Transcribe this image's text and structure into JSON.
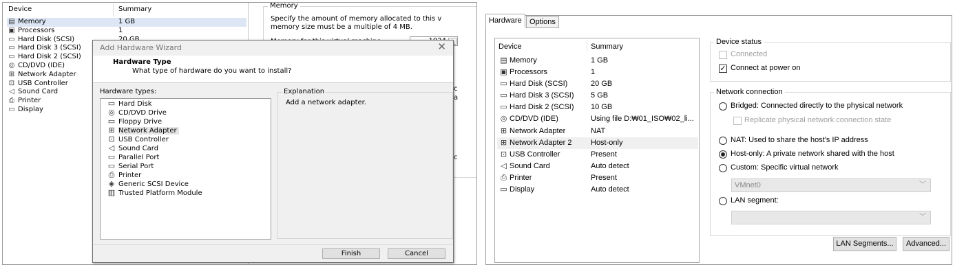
{
  "left_panel": {
    "col_device": "Device",
    "col_summary": "Summary",
    "devices": [
      {
        "icon": "memory-icon",
        "glyph": "▤",
        "name": "Memory",
        "summary": "1 GB"
      },
      {
        "icon": "processor-icon",
        "glyph": "▣",
        "name": "Processors",
        "summary": "1"
      },
      {
        "icon": "hard-disk-icon",
        "glyph": "▭",
        "name": "Hard Disk (SCSI)",
        "summary": "20 GB"
      },
      {
        "icon": "hard-disk-icon",
        "glyph": "▭",
        "name": "Hard Disk 3 (SCSI)",
        "summary": ""
      },
      {
        "icon": "hard-disk-icon",
        "glyph": "▭",
        "name": "Hard Disk 2 (SCSI)",
        "summary": ""
      },
      {
        "icon": "cd-dvd-icon",
        "glyph": "◎",
        "name": "CD/DVD (IDE)",
        "summary": ""
      },
      {
        "icon": "network-adapter-icon",
        "glyph": "⊞",
        "name": "Network Adapter",
        "summary": ""
      },
      {
        "icon": "usb-controller-icon",
        "glyph": "⊡",
        "name": "USB Controller",
        "summary": ""
      },
      {
        "icon": "sound-card-icon",
        "glyph": "◁",
        "name": "Sound Card",
        "summary": ""
      },
      {
        "icon": "printer-icon",
        "glyph": "⎙",
        "name": "Printer",
        "summary": ""
      },
      {
        "icon": "display-icon",
        "glyph": "▭",
        "name": "Display",
        "summary": ""
      }
    ],
    "memory": {
      "legend": "Memory",
      "desc_line1": "Specify the amount of memory allocated to this v",
      "desc_line2": "memory size must be a multiple of 4 MB.",
      "field_label": "Memory for this virtual machine:",
      "field_value": "1024"
    },
    "edge_letters": [
      "c",
      "a",
      "c"
    ]
  },
  "wizard": {
    "title": "Add Hardware Wizard",
    "close_glyph": "✕",
    "heading": "Hardware Type",
    "subheading": "What type of hardware do you want to install?",
    "types_label": "Hardware types:",
    "types": [
      {
        "icon": "hard-disk-icon",
        "glyph": "▭",
        "label": "Hard Disk"
      },
      {
        "icon": "cd-dvd-icon",
        "glyph": "◎",
        "label": "CD/DVD Drive"
      },
      {
        "icon": "floppy-drive-icon",
        "glyph": "▭",
        "label": "Floppy Drive"
      },
      {
        "icon": "network-adapter-icon",
        "glyph": "⊞",
        "label": "Network Adapter",
        "selected": true
      },
      {
        "icon": "usb-controller-icon",
        "glyph": "⊡",
        "label": "USB Controller"
      },
      {
        "icon": "sound-card-icon",
        "glyph": "◁",
        "label": "Sound Card"
      },
      {
        "icon": "parallel-port-icon",
        "glyph": "▭",
        "label": "Parallel Port"
      },
      {
        "icon": "serial-port-icon",
        "glyph": "▭",
        "label": "Serial Port"
      },
      {
        "icon": "printer-icon",
        "glyph": "⎙",
        "label": "Printer"
      },
      {
        "icon": "generic-scsi-icon",
        "glyph": "◈",
        "label": "Generic SCSI Device"
      },
      {
        "icon": "tpm-icon",
        "glyph": "▥",
        "label": "Trusted Platform Module"
      }
    ],
    "explanation_legend": "Explanation",
    "explanation_text": "Add a network adapter.",
    "finish_label": "Finish",
    "cancel_label": "Cancel"
  },
  "right_panel": {
    "tabs": [
      {
        "label": "Hardware",
        "active": true
      },
      {
        "label": "Options",
        "active": false
      }
    ],
    "col_device": "Device",
    "col_summary": "Summary",
    "devices": [
      {
        "icon": "memory-icon",
        "glyph": "▤",
        "name": "Memory",
        "summary": "1 GB"
      },
      {
        "icon": "processor-icon",
        "glyph": "▣",
        "name": "Processors",
        "summary": "1"
      },
      {
        "icon": "hard-disk-icon",
        "glyph": "▭",
        "name": "Hard Disk (SCSI)",
        "summary": "20 GB"
      },
      {
        "icon": "hard-disk-icon",
        "glyph": "▭",
        "name": "Hard Disk 3 (SCSI)",
        "summary": "5 GB"
      },
      {
        "icon": "hard-disk-icon",
        "glyph": "▭",
        "name": "Hard Disk 2 (SCSI)",
        "summary": "10 GB"
      },
      {
        "icon": "cd-dvd-icon",
        "glyph": "◎",
        "name": "CD/DVD (IDE)",
        "summary": "Using file D:₩01_ISO₩02_li..."
      },
      {
        "icon": "network-adapter-icon",
        "glyph": "⊞",
        "name": "Network Adapter",
        "summary": "NAT"
      },
      {
        "icon": "network-adapter-icon",
        "glyph": "⊞",
        "name": "Network Adapter 2",
        "summary": "Host-only",
        "selected": true
      },
      {
        "icon": "usb-controller-icon",
        "glyph": "⊡",
        "name": "USB Controller",
        "summary": "Present"
      },
      {
        "icon": "sound-card-icon",
        "glyph": "◁",
        "name": "Sound Card",
        "summary": "Auto detect"
      },
      {
        "icon": "printer-icon",
        "glyph": "⎙",
        "name": "Printer",
        "summary": "Present"
      },
      {
        "icon": "display-icon",
        "glyph": "▭",
        "name": "Display",
        "summary": "Auto detect"
      }
    ],
    "device_status": {
      "legend": "Device status",
      "connected": {
        "label": "Connected",
        "checked": false,
        "disabled": true
      },
      "connect_at_power_on": {
        "label": "Connect at power on",
        "checked": true
      }
    },
    "network_connection": {
      "legend": "Network connection",
      "bridged": {
        "label": "Bridged: Connected directly to the physical network",
        "selected": false
      },
      "replicate": {
        "label": "Replicate physical network connection state",
        "checked": false,
        "disabled": true
      },
      "nat": {
        "label": "NAT: Used to share the host's IP address",
        "selected": false
      },
      "host_only": {
        "label": "Host-only: A private network shared with the host",
        "selected": true
      },
      "custom": {
        "label": "Custom: Specific virtual network",
        "selected": false
      },
      "custom_select_value": "VMnet0",
      "lan_segment": {
        "label": "LAN segment:",
        "selected": false
      },
      "lan_select_value": ""
    },
    "lan_segments_button": "LAN Segments...",
    "advanced_button": "Advanced..."
  }
}
